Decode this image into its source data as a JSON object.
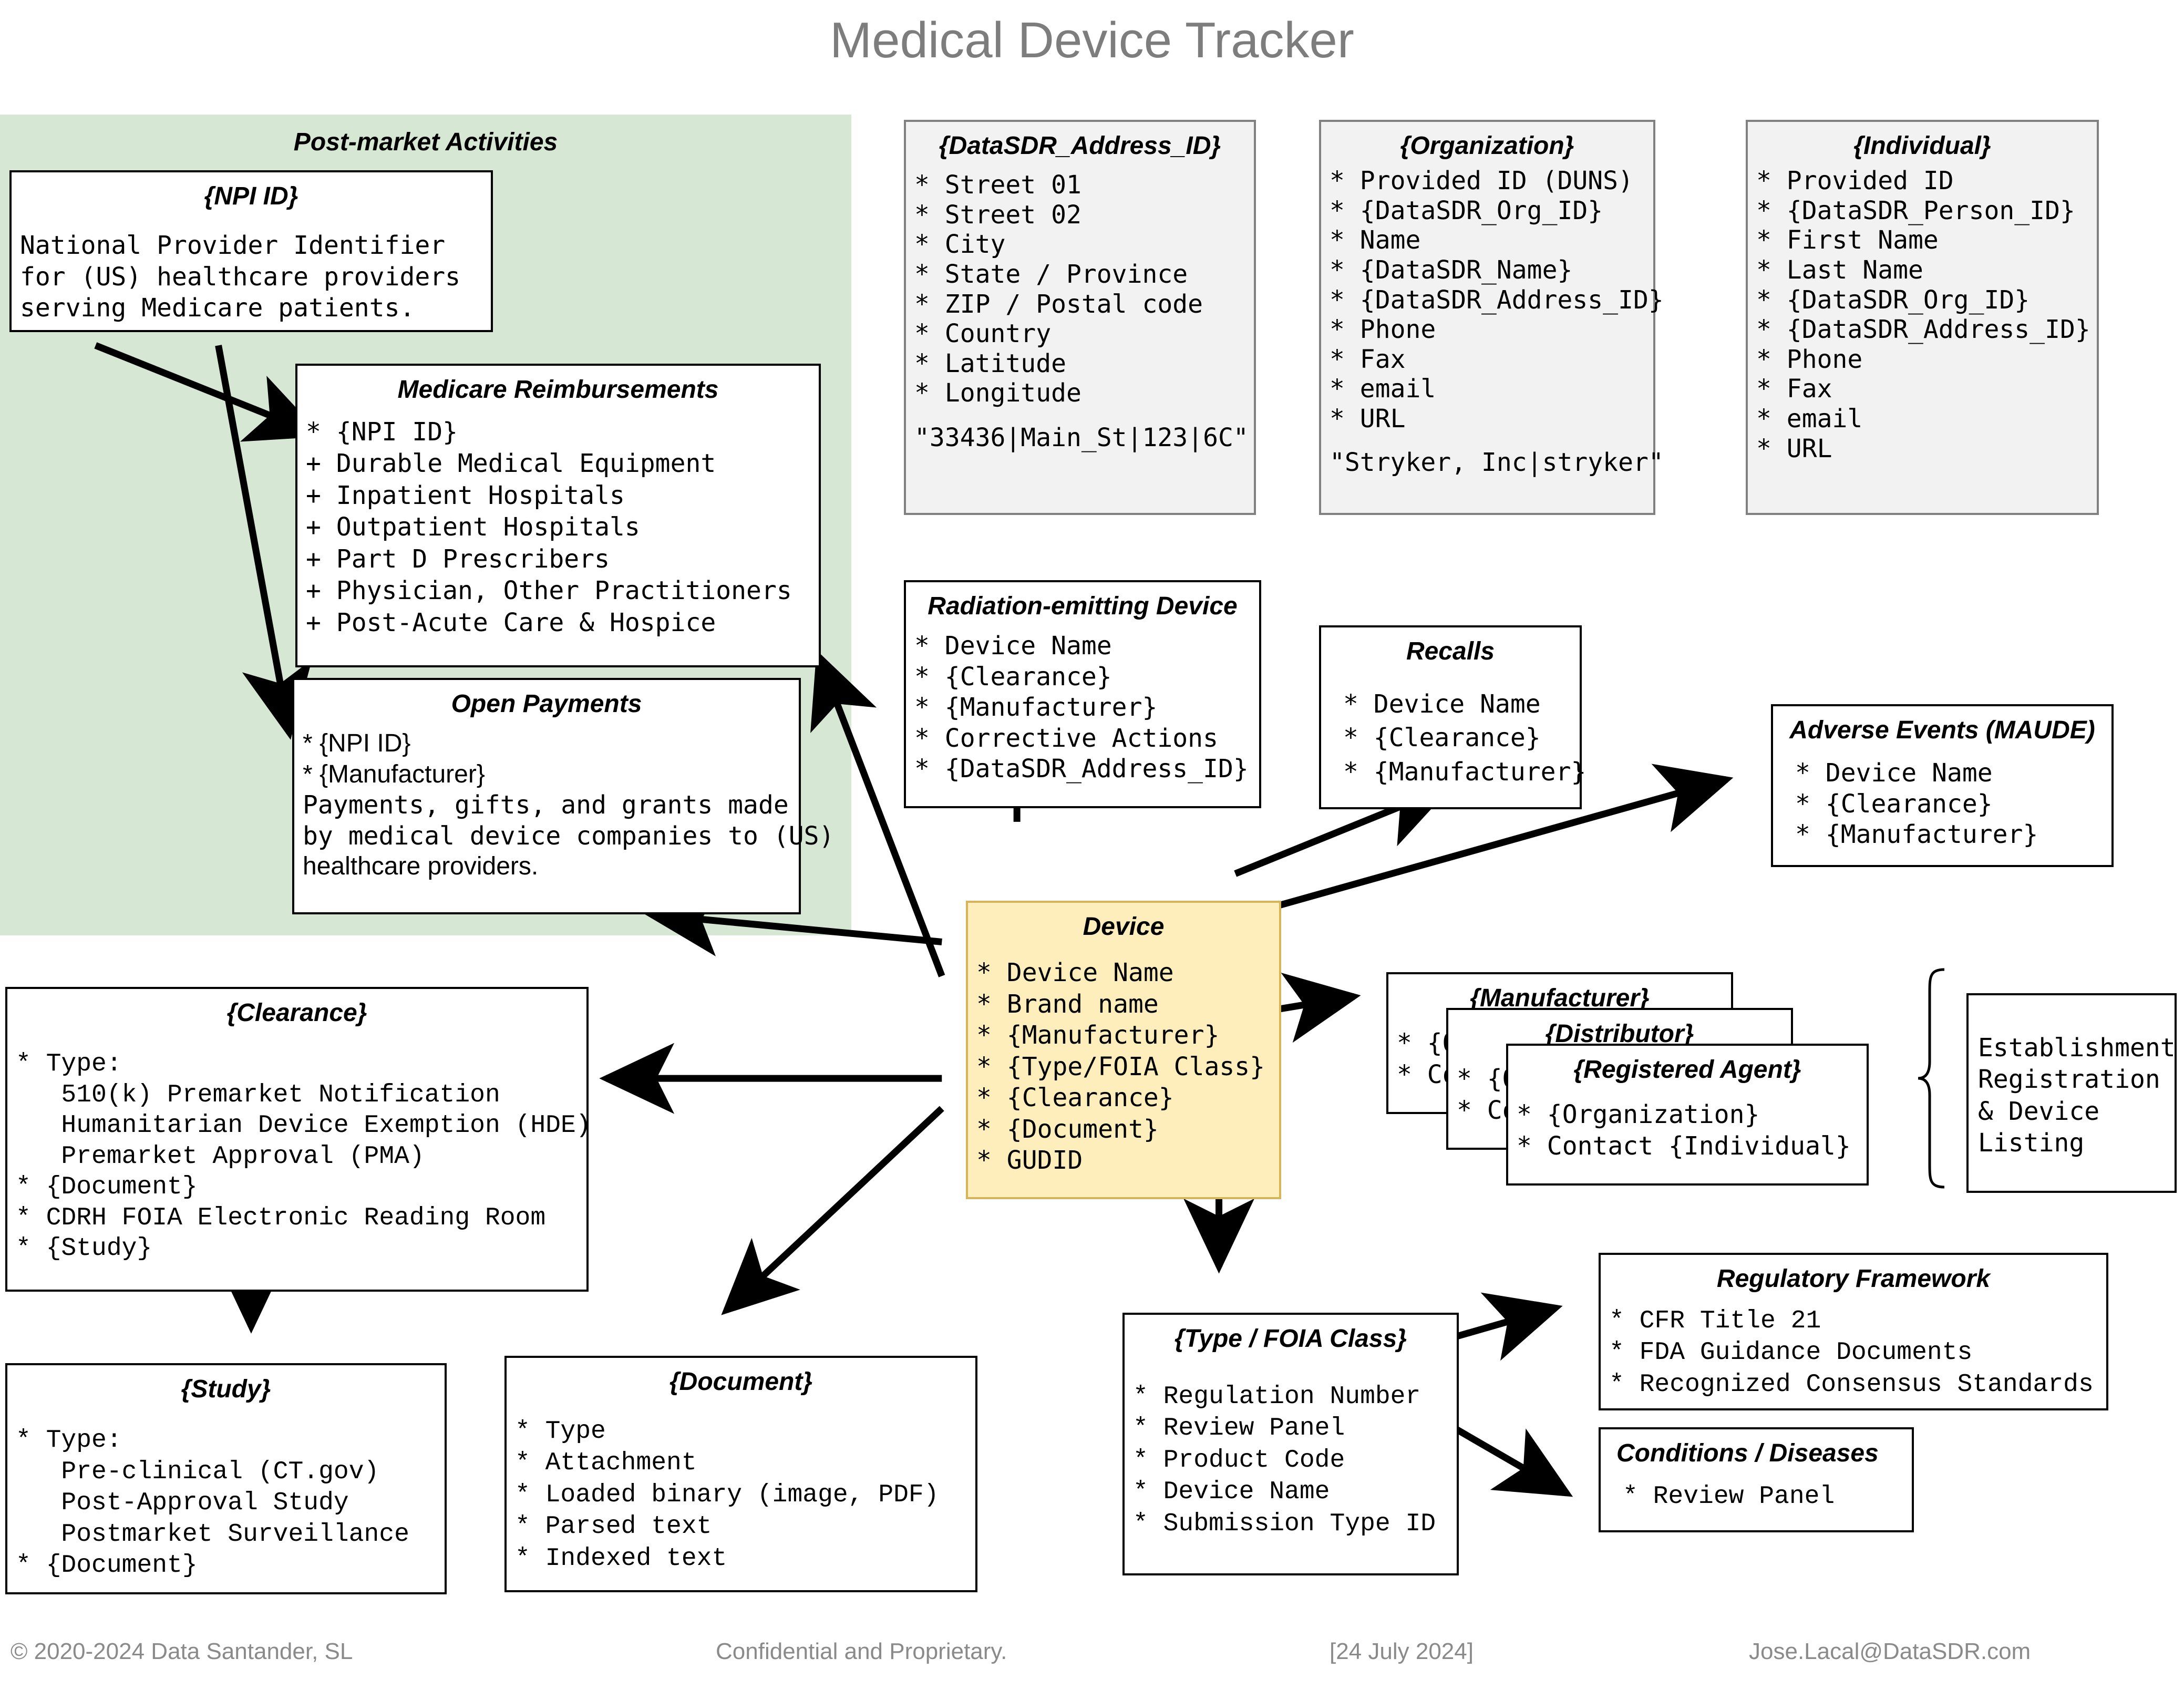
{
  "title": "Medical Device Tracker",
  "green_panel": {
    "label": "Post-market Activities",
    "color": "#d6e8d3"
  },
  "accent_colors": {
    "device_fill": "#fdeebc",
    "device_border": "#d6b45a",
    "grey_fill": "#f2f2f2",
    "grey_border": "#808080",
    "green_fill": "#d6e8d3"
  },
  "boxes": {
    "npi_id": {
      "title": "{NPI ID}",
      "lines": [
        "National Provider Identifier",
        "for (US) healthcare providers",
        "serving Medicare patients."
      ]
    },
    "medicare_reimbursements": {
      "title": "Medicare Reimbursements",
      "lines": [
        "* {NPI ID}",
        "+ Durable Medical Equipment",
        "+ Inpatient Hospitals",
        "+ Outpatient Hospitals",
        "+ Part D Prescribers",
        "+ Physician, Other Practitioners",
        "+ Post-Acute Care & Hospice"
      ]
    },
    "open_payments": {
      "title": "Open Payments",
      "lines": [
        "* {NPI ID}",
        "* {Manufacturer}",
        "Payments, gifts, and grants made",
        "by medical device companies to (US)",
        "healthcare providers."
      ]
    },
    "datasdr_address_id": {
      "title": "{DataSDR_Address_ID}",
      "lines": [
        "* Street 01",
        "* Street 02",
        "* City",
        "* State / Province",
        "* ZIP / Postal code",
        "* Country",
        "* Latitude",
        "* Longitude"
      ],
      "example": "\"33436|Main_St|123|6C\""
    },
    "organization": {
      "title": "{Organization}",
      "lines": [
        "* Provided ID (DUNS)",
        "* {DataSDR_Org_ID}",
        "* Name",
        "* {DataSDR_Name}",
        "* {DataSDR_Address_ID}",
        "* Phone",
        "* Fax",
        "* email",
        "* URL"
      ],
      "example": "\"Stryker, Inc|stryker\""
    },
    "individual": {
      "title": "{Individual}",
      "lines": [
        "* Provided ID",
        "* {DataSDR_Person_ID}",
        "* First Name",
        "* Last Name",
        "* {DataSDR_Org_ID}",
        "* {DataSDR_Address_ID}",
        "* Phone",
        "* Fax",
        "* email",
        "* URL"
      ]
    },
    "radiation_emitting_device": {
      "title": "Radiation-emitting Device",
      "lines": [
        "* Device Name",
        "* {Clearance}",
        "* {Manufacturer}",
        "* Corrective Actions",
        "* {DataSDR_Address_ID}"
      ]
    },
    "recalls": {
      "title": "Recalls",
      "lines": [
        "* Device Name",
        "* {Clearance}",
        "* {Manufacturer}"
      ]
    },
    "adverse_events": {
      "title": "Adverse Events (MAUDE)",
      "lines": [
        "* Device Name",
        "* {Clearance}",
        "* {Manufacturer}"
      ]
    },
    "device": {
      "title": "Device",
      "lines": [
        "* Device Name",
        "* Brand name",
        "* {Manufacturer}",
        "* {Type/FOIA Class}",
        "* {Clearance}",
        "* {Document}",
        "* GUDID"
      ]
    },
    "manufacturer": {
      "title": "{Manufacturer}",
      "lines": [
        "* {Organization}",
        "* Contact {Individual}"
      ]
    },
    "distributor": {
      "title": "{Distributor}",
      "lines": [
        "* {Organization}",
        "* Contact {Individual}"
      ]
    },
    "registered_agent": {
      "title": "{Registered Agent}",
      "lines": [
        "* {Organization}",
        "* Contact {Individual}"
      ]
    },
    "establishment_registration": {
      "lines": [
        "Establishment",
        "Registration",
        "& Device",
        "Listing"
      ]
    },
    "clearance": {
      "title": "{Clearance}",
      "lines": [
        "* Type:",
        "   510(k) Premarket Notification",
        "   Humanitarian Device Exemption (HDE)",
        "   Premarket Approval (PMA)",
        "* {Document}",
        "* CDRH FOIA Electronic Reading Room",
        "* {Study}"
      ]
    },
    "study": {
      "title": "{Study}",
      "lines": [
        "* Type:",
        "   Pre-clinical (CT.gov)",
        "   Post-Approval Study",
        "   Postmarket Surveillance",
        "* {Document}"
      ]
    },
    "document": {
      "title": "{Document}",
      "lines": [
        "* Type",
        "* Attachment",
        "* Loaded binary (image, PDF)",
        "* Parsed text",
        "* Indexed text"
      ]
    },
    "type_foia_class": {
      "title": "{Type / FOIA Class}",
      "lines": [
        "* Regulation Number",
        "* Review Panel",
        "* Product Code",
        "* Device Name",
        "* Submission Type ID"
      ]
    },
    "regulatory_framework": {
      "title": "Regulatory Framework",
      "lines": [
        "* CFR Title 21",
        "* FDA Guidance Documents",
        "* Recognized Consensus Standards"
      ]
    },
    "conditions_diseases": {
      "title": "Conditions / Diseases",
      "lines": [
        "* Review Panel"
      ]
    }
  },
  "footer": {
    "copyright": "© 2020-2024 Data Santander, SL",
    "confidential": "Confidential and Proprietary.",
    "date": "[24 July 2024]",
    "contact": "Jose.Lacal@DataSDR.com"
  }
}
